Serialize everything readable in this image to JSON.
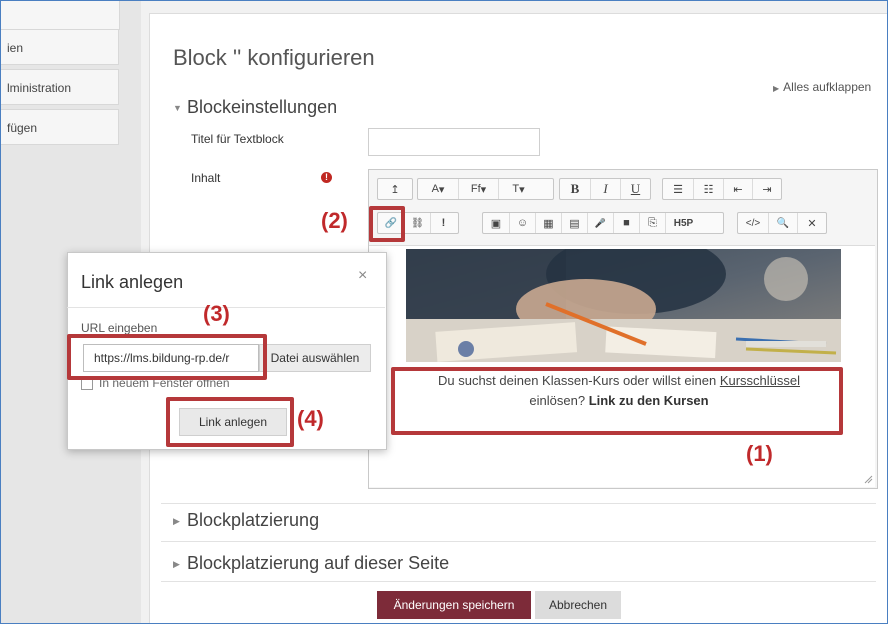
{
  "sidebar": {
    "items": [
      {
        "label": "ien"
      },
      {
        "label": "lministration"
      },
      {
        "label": "fügen"
      }
    ]
  },
  "page": {
    "title": "Block '' konfigurieren",
    "expand_all": "Alles aufklappen"
  },
  "sections": {
    "settings": "Blockeinstellungen",
    "placement": "Blockplatzierung",
    "placement_page": "Blockplatzierung auf dieser Seite"
  },
  "form": {
    "title_label": "Titel für Textblock",
    "content_label": "Inhalt",
    "required_mark": "!"
  },
  "toolbar": {
    "row1": [
      "↥",
      "A",
      "Ff",
      "T",
      "B",
      "I",
      "U",
      "☰",
      "☷",
      "⇤",
      "⇥"
    ],
    "row2": [
      "🔗",
      "⛓",
      "!",
      "▣",
      "☺",
      "▦",
      "▤",
      "🎤",
      "■",
      "⎘",
      "H5P",
      "</>",
      "🔍",
      "✕"
    ]
  },
  "editor": {
    "text_pre": "Du suchst deinen Klassen-Kurs oder willst einen",
    "text_link": "Kursschlüssel",
    "text_mid": "einlösen?",
    "text_bold": "Link zu den Kursen"
  },
  "modal": {
    "title": "Link anlegen",
    "close": "×",
    "url_label": "URL eingeben",
    "url_value": "https://lms.bildung-rp.de/r",
    "file_button": "Datei auswählen",
    "new_window": "In neuem Fenster öffnen",
    "create_button": "Link anlegen"
  },
  "annotations": [
    "(1)",
    "(2)",
    "(3)",
    "(4)"
  ],
  "buttons": {
    "save": "Änderungen speichern",
    "cancel": "Abbrechen"
  },
  "colors": {
    "accent": "#7d2b39",
    "annotation": "#b5383a",
    "required": "#c02822"
  }
}
